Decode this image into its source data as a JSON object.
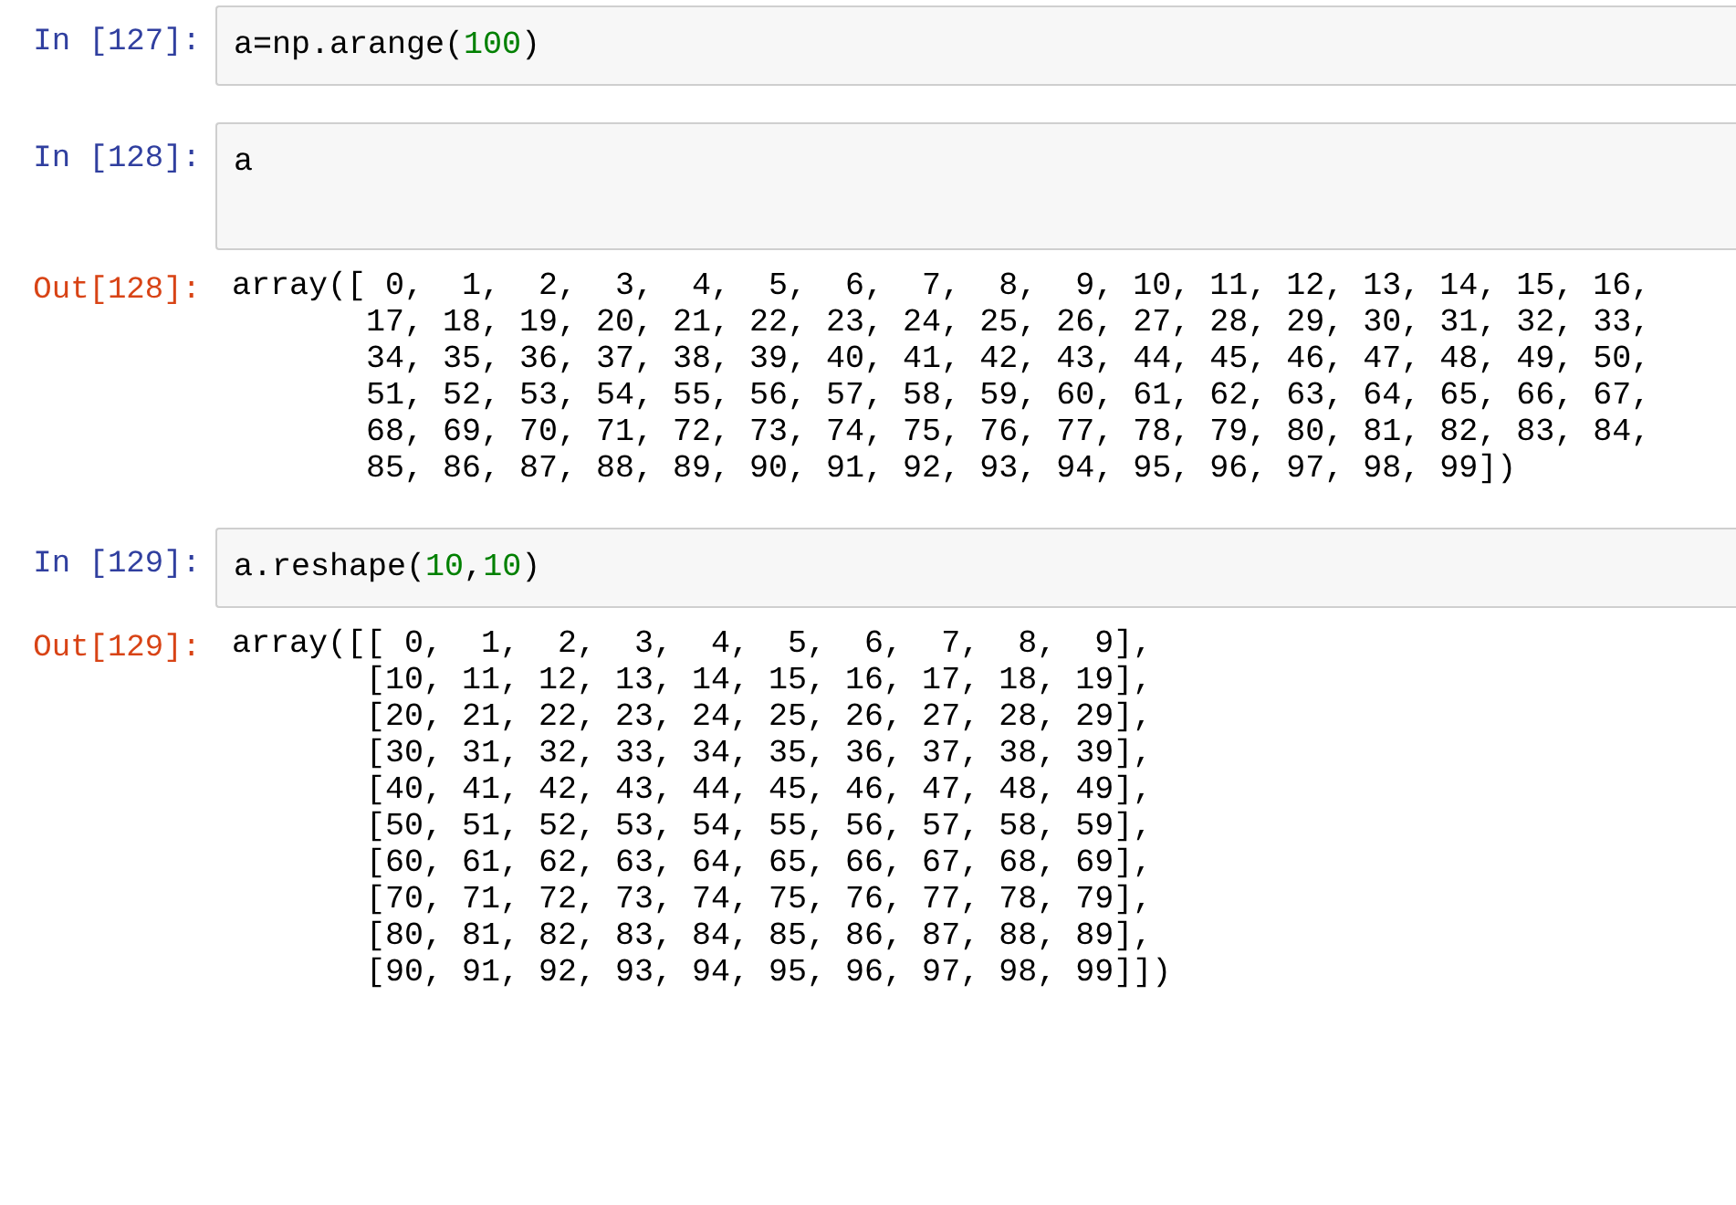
{
  "cells": [
    {
      "prompt": "In [127]:",
      "code": [
        {
          "text": "a=np.arange(",
          "kind": "plain"
        },
        {
          "text": "100",
          "kind": "number"
        },
        {
          "text": ")",
          "kind": "plain"
        }
      ]
    },
    {
      "prompt": "In [128]:",
      "code": [
        {
          "text": "a\n",
          "kind": "plain"
        }
      ],
      "output": {
        "prompt": "Out[128]:",
        "text": "array([ 0,  1,  2,  3,  4,  5,  6,  7,  8,  9, 10, 11, 12, 13, 14, 15, 16,\n       17, 18, 19, 20, 21, 22, 23, 24, 25, 26, 27, 28, 29, 30, 31, 32, 33,\n       34, 35, 36, 37, 38, 39, 40, 41, 42, 43, 44, 45, 46, 47, 48, 49, 50,\n       51, 52, 53, 54, 55, 56, 57, 58, 59, 60, 61, 62, 63, 64, 65, 66, 67,\n       68, 69, 70, 71, 72, 73, 74, 75, 76, 77, 78, 79, 80, 81, 82, 83, 84,\n       85, 86, 87, 88, 89, 90, 91, 92, 93, 94, 95, 96, 97, 98, 99])"
      }
    },
    {
      "prompt": "In [129]:",
      "code": [
        {
          "text": "a.reshape(",
          "kind": "plain"
        },
        {
          "text": "10",
          "kind": "number"
        },
        {
          "text": ",",
          "kind": "plain"
        },
        {
          "text": "10",
          "kind": "number"
        },
        {
          "text": ")",
          "kind": "plain"
        }
      ],
      "output": {
        "prompt": "Out[129]:",
        "text": "array([[ 0,  1,  2,  3,  4,  5,  6,  7,  8,  9],\n       [10, 11, 12, 13, 14, 15, 16, 17, 18, 19],\n       [20, 21, 22, 23, 24, 25, 26, 27, 28, 29],\n       [30, 31, 32, 33, 34, 35, 36, 37, 38, 39],\n       [40, 41, 42, 43, 44, 45, 46, 47, 48, 49],\n       [50, 51, 52, 53, 54, 55, 56, 57, 58, 59],\n       [60, 61, 62, 63, 64, 65, 66, 67, 68, 69],\n       [70, 71, 72, 73, 74, 75, 76, 77, 78, 79],\n       [80, 81, 82, 83, 84, 85, 86, 87, 88, 89],\n       [90, 91, 92, 93, 94, 95, 96, 97, 98, 99]])"
      }
    }
  ]
}
